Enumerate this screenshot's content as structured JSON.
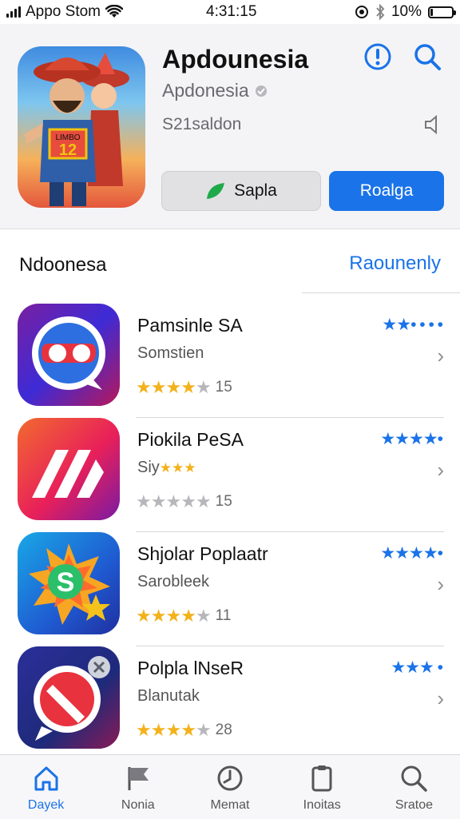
{
  "status_bar": {
    "carrier": "Appo Stom",
    "time": "4:31:15",
    "battery": "10%",
    "battery_level": 0.1
  },
  "featured": {
    "title": "Apdounesia",
    "subtitle": "Apdonesia",
    "size_text": "S21saldon",
    "get_label": "Sapla",
    "open_label": "Roalga",
    "accent_color": "#1a73e8"
  },
  "section": {
    "title": "Ndoonesa",
    "link": "Raounenly"
  },
  "apps": [
    {
      "name": "Pamsinle SA",
      "category": "Somstien",
      "rating_stars": 4,
      "rating_count": "15",
      "blue_rating": "★★• • • •",
      "icon": "chat-bubble-icon"
    },
    {
      "name": "Piokila PeSA",
      "category": "Siy",
      "rating_stars": 0,
      "rating_count": "15",
      "blue_rating": "★★★★•",
      "icon": "stripes-icon"
    },
    {
      "name": "Shjolar Poplaatr",
      "category": "Sarobleek",
      "rating_stars": 4,
      "rating_count": "11",
      "blue_rating": "★★★★•",
      "icon": "star-s-icon"
    },
    {
      "name": "Polpla lNseR",
      "category": "Blanutak",
      "rating_stars": 4,
      "rating_count": "28",
      "blue_rating": "★★★ •",
      "icon": "no-sign-icon"
    }
  ],
  "tabs": [
    {
      "label": "Dayek",
      "icon": "home-icon",
      "active": true
    },
    {
      "label": "Nonia",
      "icon": "flag-icon",
      "active": false
    },
    {
      "label": "Memat",
      "icon": "clock-icon",
      "active": false
    },
    {
      "label": "Inoitas",
      "icon": "clipboard-icon",
      "active": false
    },
    {
      "label": "Sratoe",
      "icon": "search-icon",
      "active": false
    }
  ]
}
